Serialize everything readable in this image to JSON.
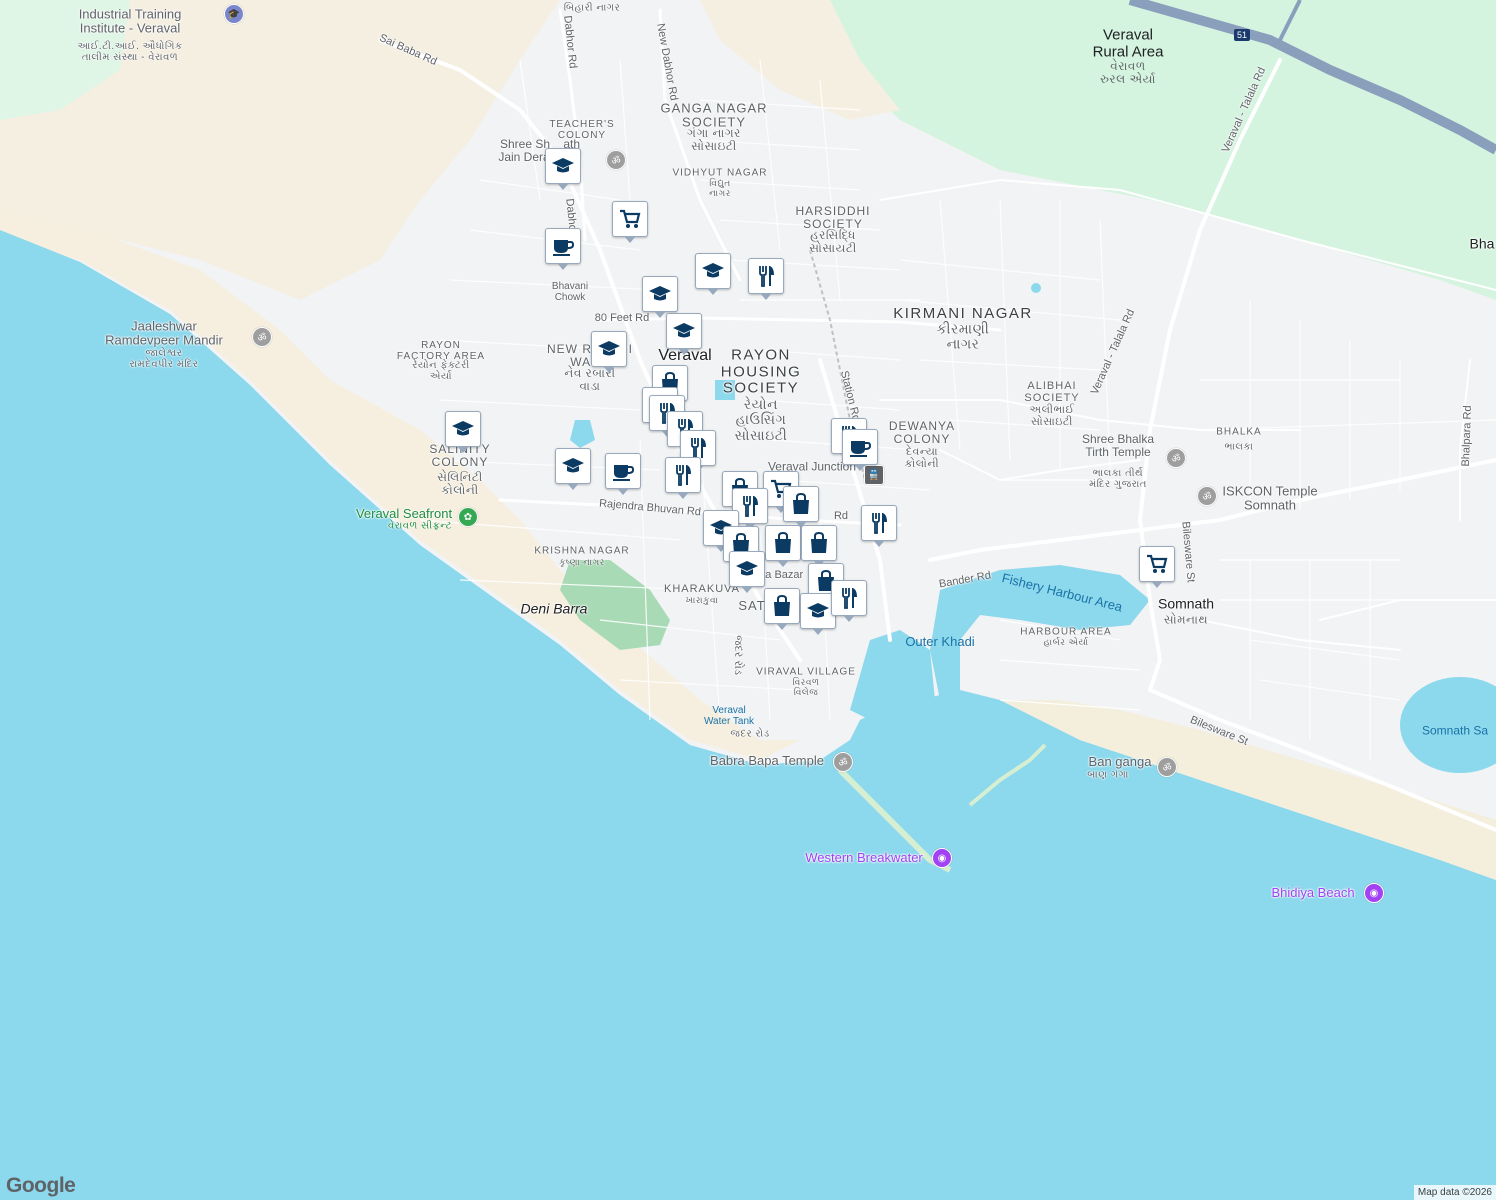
{
  "colors": {
    "sea": "#8cd8ec",
    "land": "#f1f3f4",
    "beach": "#f6efdf",
    "green": "#d8f5e2",
    "park": "#a8dab5",
    "road": "#ffffff",
    "highway": "#8a9fbb",
    "marker_icon": "#0b3b63"
  },
  "labels": {
    "veraval_rural": "Veraval\nRural Area",
    "veraval_rural_gu": "વેરાવળ\nરુરલ એર્યા",
    "ganga_nagar": "GANGA NAGAR\nSOCIETY",
    "ganga_nagar_gu": "ગંગા નાગર\nસોસાઇટી",
    "teachers_colony": "TEACHER'S\nCOLONY",
    "vidhyut_nagar": "VIDHYUT NAGAR",
    "vidhyut_nagar_gu": "વિદ્યુત\nનાગર",
    "harsiddhi": "HARSIDDHI\nSOCIETY",
    "harsiddhi_gu": "હરસિદ્ધિ\nસોસાયટી",
    "kirmani_nagar": "KIRMANI NAGAR",
    "kirmani_nagar_gu": "કીરમાણી\nનાગર",
    "rayon_housing": "RAYON\nHOUSING\nSOCIETY",
    "rayon_housing_gu": "રેયોન\nહાઉસિંગ\nસોસાઇટી",
    "rayon_factory": "RAYON\nFACTORY AREA",
    "rayon_factory_gu": "રેયોન ફેક્ટરી\nએર્યા",
    "new_rabari": "NEW RABARI\nWADA",
    "new_rabari_gu": "નેવ રબારી\nવાડા",
    "veraval": "Veraval",
    "dewanya": "DEWANYA\nCOLONY",
    "dewanya_gu": "દેવન્યા\nકોલોની",
    "alibhai": "ALIBHAI\nSOCIETY",
    "alibhai_gu": "અલીભાઈ\nસોસાઇટી",
    "bhalka": "BHALKA",
    "bhalka_gu": "ભાલકા",
    "salinity": "SALINITY\nCOLONY",
    "salinity_gu": "સેલિનિટી\nકોલોની",
    "krishna_nagar": "KRISHNA NAGAR",
    "krishna_nagar_gu": "કૃષ્ણા નાગર",
    "kharakuva": "KHARAKUVA",
    "kharakuva_gu": "ખારાકુવા",
    "viraval_village": "VIRAVAL VILLAGE",
    "viraval_village_gu": "વિરવળ\nવિલેજ",
    "harbour_area": "HARBOUR AREA",
    "harbour_area_gu": "હાર્બર એર્યા",
    "somnath": "Somnath",
    "somnath_gu": "સોમનાથ",
    "deni_barra": "Deni Barra",
    "fishery_harbour": "Fishery Harbour Area",
    "outer_khadi": "Outer Khadi",
    "somnath_sea": "Somnath Sa",
    "water_tank": "Veraval\nWater Tank",
    "jadar_road": "જદર રોડ",
    "bha": "Bha",
    "iti": "Industrial Training\nInstitute - Veraval",
    "iti_gu": "આઈ.ટી.આઈ. ઔધોગિક\nતાલીમ સંસ્થા - વેરાવળ",
    "jain_derasar": "Shree Sh    ath\nJain Deras   ain",
    "jaaleshwar": "Jaaleshwar\nRamdevpeer Mandir",
    "jaaleshwar_gu": "જાલેશ્વર\nરામદેવપીર મંદિર",
    "veraval_seafront": "Veraval Seafront",
    "veraval_seafront_gu": "વેરાવળ સીફ્રન્ટ",
    "bhalka_tirth": "Shree Bhalka\nTirth Temple",
    "bhalka_tirth_gu": "ભાલકા તીર્થ\nમંદિર ગુજરાત",
    "iskcon": "ISKCON Temple\nSomnath",
    "babra_bapa": "Babra Bapa Temple",
    "western_breakwater": "Western Breakwater",
    "ban_ganga": "Ban ganga",
    "ban_ganga_gu": "બાણ ગંગા",
    "bhidiya_beach": "Bhidiya Beach",
    "veraval_junction": "Veraval Junction",
    "bihari_nagar": "બિહારી નાગર",
    "bhavani_chowk": "Bhavani\nChowk",
    "sata_bazar": "Sata Bazar",
    "sat": "SAT",
    "highway_shield": "51"
  },
  "roads": {
    "sai_baba": "Sai Baba Rd",
    "dabhor": "Dabhor Rd",
    "new_dabhor": "New Dabhor Rd",
    "dabhor2": "Dabhor Rd",
    "eighty_feet": "80 Feet Rd",
    "rajendra": "Rajendra Bhuvan Rd",
    "station": "Station Rd",
    "bander": "Bander Rd",
    "veraval_talala": "Veraval - Talala Rd",
    "veraval_talala2": "Veraval - Talala Rd",
    "bilesware": "Bilesware St",
    "bilesware2": "Bilesware St",
    "bhalpara": "Bhalpara Rd",
    "jadar": "જદર રોડ",
    "road_rd": "Rd"
  },
  "markers": [
    {
      "type": "school"
    },
    {
      "type": "cart"
    },
    {
      "type": "coffee"
    },
    {
      "type": "school"
    },
    {
      "type": "food"
    },
    {
      "type": "school"
    },
    {
      "type": "school"
    },
    {
      "type": "school"
    },
    {
      "type": "bag"
    },
    {
      "type": "food"
    },
    {
      "type": "food"
    },
    {
      "type": "food"
    },
    {
      "type": "food"
    },
    {
      "type": "school"
    },
    {
      "type": "coffee"
    },
    {
      "type": "food"
    },
    {
      "type": "bag"
    },
    {
      "type": "cart"
    },
    {
      "type": "food"
    },
    {
      "type": "bag"
    },
    {
      "type": "school"
    },
    {
      "type": "bag"
    },
    {
      "type": "bag"
    },
    {
      "type": "bag"
    },
    {
      "type": "school"
    },
    {
      "type": "bag"
    },
    {
      "type": "bag"
    },
    {
      "type": "school"
    },
    {
      "type": "food"
    },
    {
      "type": "food"
    },
    {
      "type": "food"
    },
    {
      "type": "coffee"
    },
    {
      "type": "cart"
    },
    {
      "type": "school"
    }
  ],
  "attribution": {
    "logo": "Google",
    "map_data": "Map data ©2026"
  }
}
